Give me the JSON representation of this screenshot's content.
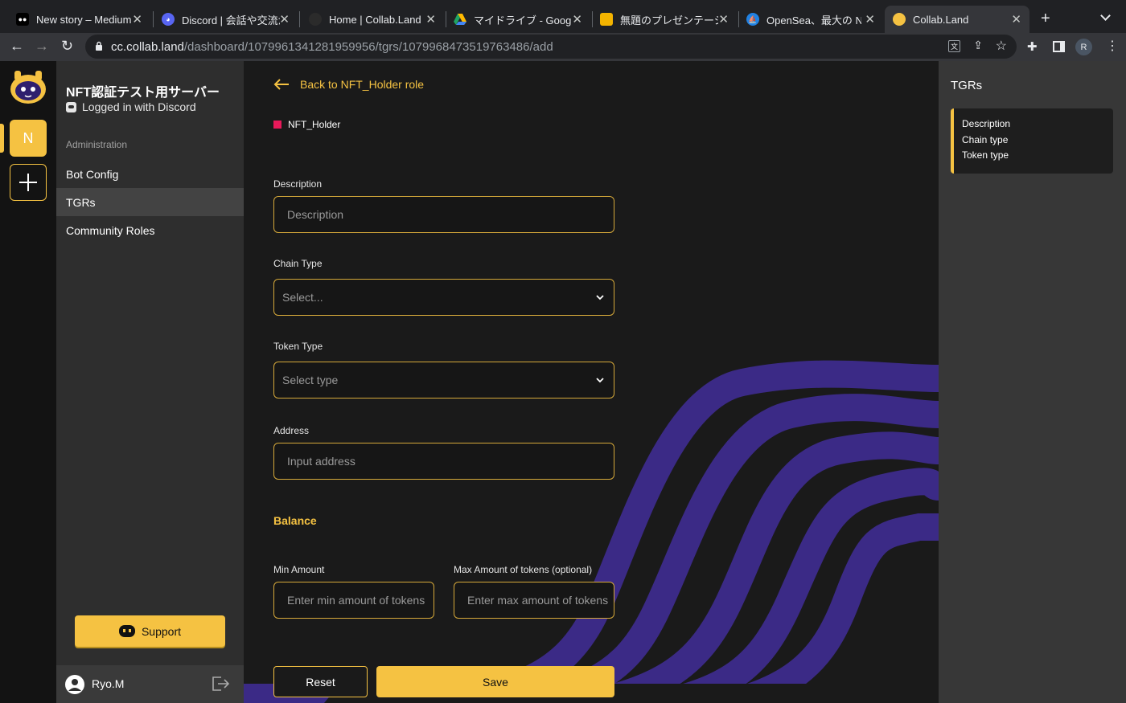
{
  "browser": {
    "tabs": [
      {
        "title": "New story – Medium",
        "icon": "medium-icon",
        "color": "#000000"
      },
      {
        "title": "Discord | 会話や交流が",
        "icon": "discord-icon",
        "color": "#5865f2"
      },
      {
        "title": "Home | Collab.Land",
        "icon": "collabland-icon",
        "color": "#2b2b2b"
      },
      {
        "title": "マイドライブ - Google",
        "icon": "google-drive-icon",
        "color": "#1fa463"
      },
      {
        "title": "無題のプレゼンテーショ",
        "icon": "google-slides-icon",
        "color": "#f4b400"
      },
      {
        "title": "OpenSea、最大の NFT",
        "icon": "opensea-icon",
        "color": "#2081e2"
      },
      {
        "title": "Collab.Land",
        "icon": "collabland-icon",
        "color": "#f5c242"
      }
    ],
    "url_host": "cc.collab.land",
    "url_path": "/dashboard/1079961341281959956/tgrs/1079968473519763486/add",
    "profile_initial": "R"
  },
  "rail": {
    "server_initial": "N"
  },
  "sidebar": {
    "server_name": "NFT認証テスト用サーバー",
    "login_status": "Logged in with Discord",
    "section_title": "Administration",
    "items": [
      "Bot Config",
      "TGRs",
      "Community Roles"
    ],
    "active_item": "TGRs",
    "support_label": "Support",
    "user_name": "Ryo.M"
  },
  "main": {
    "back_label": "Back to NFT_Holder role",
    "role_name": "NFT_Holder",
    "role_color": "#e8195a",
    "description": {
      "label": "Description",
      "placeholder": "Description"
    },
    "chain_type": {
      "label": "Chain Type",
      "placeholder": "Select..."
    },
    "token_type": {
      "label": "Token Type",
      "placeholder": "Select type"
    },
    "address": {
      "label": "Address",
      "placeholder": "Input address"
    },
    "balance_title": "Balance",
    "min_amount": {
      "label": "Min Amount",
      "placeholder": "Enter min amount of tokens"
    },
    "max_amount": {
      "label": "Max Amount of tokens (optional)",
      "placeholder": "Enter max amount of tokens"
    },
    "reset_label": "Reset",
    "save_label": "Save"
  },
  "right_panel": {
    "title": "TGRs",
    "items": [
      "Description",
      "Chain type",
      "Token type"
    ]
  },
  "colors": {
    "accent": "#f5c242",
    "wave": "#3b2a86",
    "field_border": "#d6a93a"
  }
}
